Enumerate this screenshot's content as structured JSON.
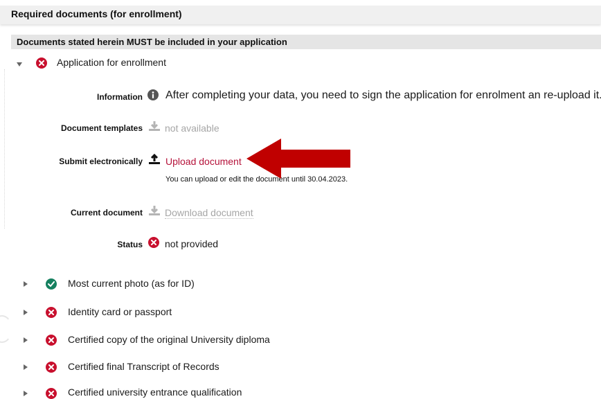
{
  "section": {
    "title": "Required documents (for enrollment)",
    "subtitle": "Documents stated herein MUST be included in your application"
  },
  "expanded_item": {
    "label": "Application for enrollment",
    "status_icon": "error-x-icon",
    "fields": {
      "information_label": "Information",
      "information_text": "After completing your data, you need to sign the application for enrolment an re-upload it.",
      "templates_label": "Document templates",
      "templates_value": "not available",
      "submit_label": "Submit electronically",
      "submit_link": "Upload document",
      "submit_note": "You can upload or edit the document until 30.04.2023.",
      "current_label": "Current document",
      "current_link": "Download document",
      "status_label": "Status",
      "status_value": "not provided"
    }
  },
  "items": [
    {
      "label": "Most current photo (as for ID)",
      "status": "ok"
    },
    {
      "label": "Identity card or passport",
      "status": "error"
    },
    {
      "label": "Certified copy of the original University diploma",
      "status": "error"
    },
    {
      "label": "Certified final Transcript of Records",
      "status": "error"
    },
    {
      "label": "Certified university entrance qualification",
      "status": "error"
    }
  ],
  "colors": {
    "error": "#c8102e",
    "ok": "#15805f",
    "link": "#b5123a",
    "annotation_arrow": "#c00000"
  }
}
